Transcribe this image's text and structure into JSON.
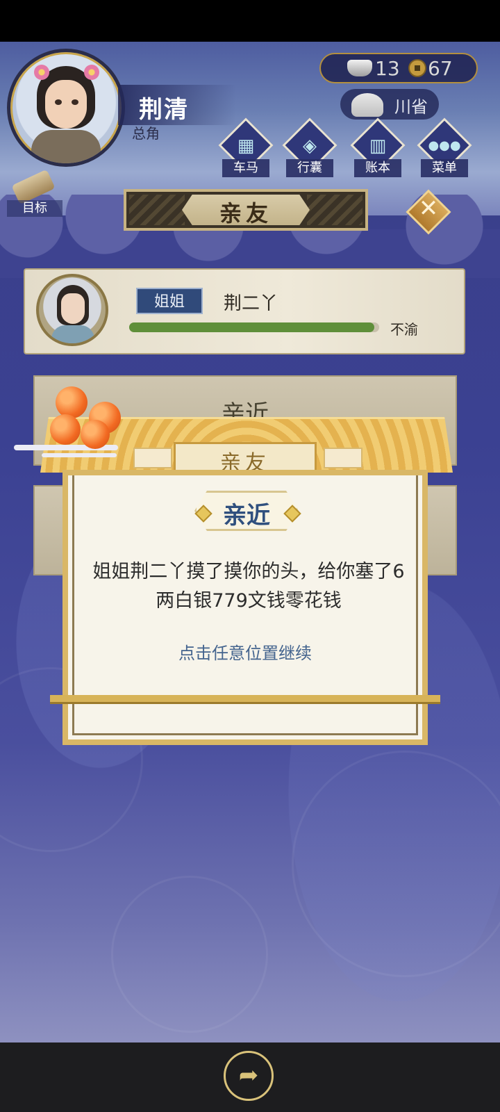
{
  "player": {
    "name": "荆清",
    "role": "总角"
  },
  "currency": {
    "silver": "13",
    "coins": "67"
  },
  "location": {
    "label": "川省"
  },
  "menu": [
    {
      "label": "车马",
      "glyph": "▦"
    },
    {
      "label": "行囊",
      "glyph": "◈"
    },
    {
      "label": "账本",
      "glyph": "▥"
    },
    {
      "label": "菜单",
      "glyph": "●●●"
    }
  ],
  "target_label": "目标",
  "page_title": "亲友",
  "close_icon": "close-icon",
  "relative": {
    "relation": "姐姐",
    "name": "荆二丫",
    "mood": "不渝",
    "affinity": 0.98,
    "bar_color": "#5f8f3a"
  },
  "action_cards": [
    {
      "label": "亲近"
    },
    {
      "label": ""
    }
  ],
  "dialog": {
    "tab_title": "亲友",
    "result_title": "亲近",
    "message": "姐姐荆二丫摸了摸你的头，给你塞了6两白银779文钱零花钱",
    "hint": "点击任意位置继续"
  },
  "colors": {
    "background": "#3b4192",
    "accent_gold": "#d9b766",
    "title_blue": "#30507e"
  }
}
